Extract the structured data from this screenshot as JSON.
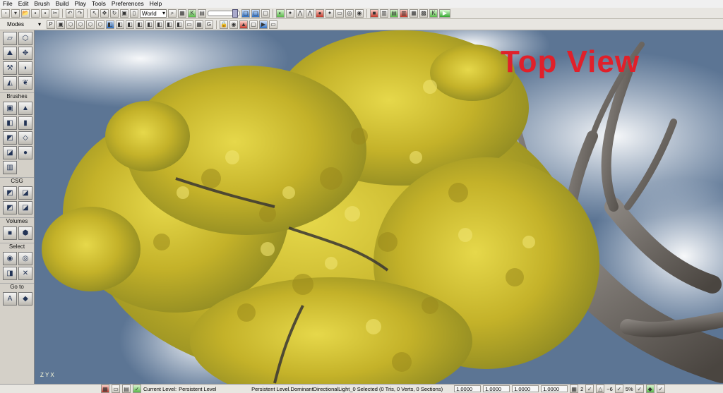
{
  "menu": [
    "File",
    "Edit",
    "Brush",
    "Build",
    "Play",
    "Tools",
    "Preferences",
    "Help"
  ],
  "toolbar": {
    "coord_system": "World",
    "modes_label": "Modes"
  },
  "sidebar": {
    "groups": [
      {
        "title": "",
        "buttons": [
          "camera-mode",
          "geometry-mode",
          "terrain-mode",
          "move-mode",
          "texture-mode",
          "mesh-paint-mode",
          "vertex-mode",
          "foliage-mode"
        ]
      },
      {
        "title": "Brushes",
        "buttons": [
          "cube-brush",
          "cone-brush",
          "cylinder-brush",
          "curved-stair-brush",
          "linear-stair-brush",
          "sheet-brush",
          "spiral-stair-brush",
          "sphere-brush",
          "volumetric-brush"
        ]
      },
      {
        "title": "CSG",
        "buttons": [
          "csg-add",
          "csg-subtract",
          "csg-intersect",
          "csg-deintersect"
        ]
      },
      {
        "title": "Volumes",
        "buttons": [
          "add-volume",
          "volume-options"
        ]
      },
      {
        "title": "Select",
        "buttons": [
          "show-selected",
          "hide-selected",
          "select-invert",
          "show-all"
        ]
      },
      {
        "title": "Go to",
        "buttons": [
          "go-to-actor",
          "go-to-builder-brush"
        ]
      }
    ]
  },
  "viewport": {
    "overlay_title": "Top View",
    "axis_label": "Z Y X"
  },
  "status": {
    "current_level_label": "Current Level:",
    "current_level_value": "Persistent Level",
    "selection": "Persistent Level.DominantDirectionalLight_0 Selected (0 Tris, 0 Verts, 0 Sections)",
    "drag_grid_1": "1.0000",
    "drag_grid_2": "1.0000",
    "drag_grid_3": "1.0000",
    "drag_grid_4": "1.0000",
    "grid_size": "2",
    "rotation_snap": "~6",
    "scale_snap": "5%"
  },
  "colors": {
    "overlay_title": "#e0202a",
    "sky": "#5c7594",
    "foliage": "#c8b52a"
  }
}
